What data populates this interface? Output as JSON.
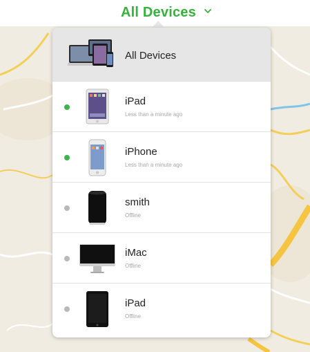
{
  "header": {
    "title": "All Devices",
    "accent_color": "#35b33a"
  },
  "devices": [
    {
      "name": "All Devices",
      "status": "",
      "icon": "all-devices-icon",
      "selected": true
    },
    {
      "name": "iPad",
      "status": "Less than a minute ago",
      "icon": "ipad-icon",
      "online": true
    },
    {
      "name": "iPhone",
      "status": "Less than a minute ago",
      "icon": "iphone-icon",
      "online": true
    },
    {
      "name": "smith",
      "status": "Offline",
      "icon": "mac-pro-icon",
      "online": false
    },
    {
      "name": "iMac",
      "status": "Offline",
      "icon": "imac-icon",
      "online": false
    },
    {
      "name": "iPad",
      "status": "Offline",
      "icon": "ipad-black-icon",
      "online": false
    }
  ]
}
